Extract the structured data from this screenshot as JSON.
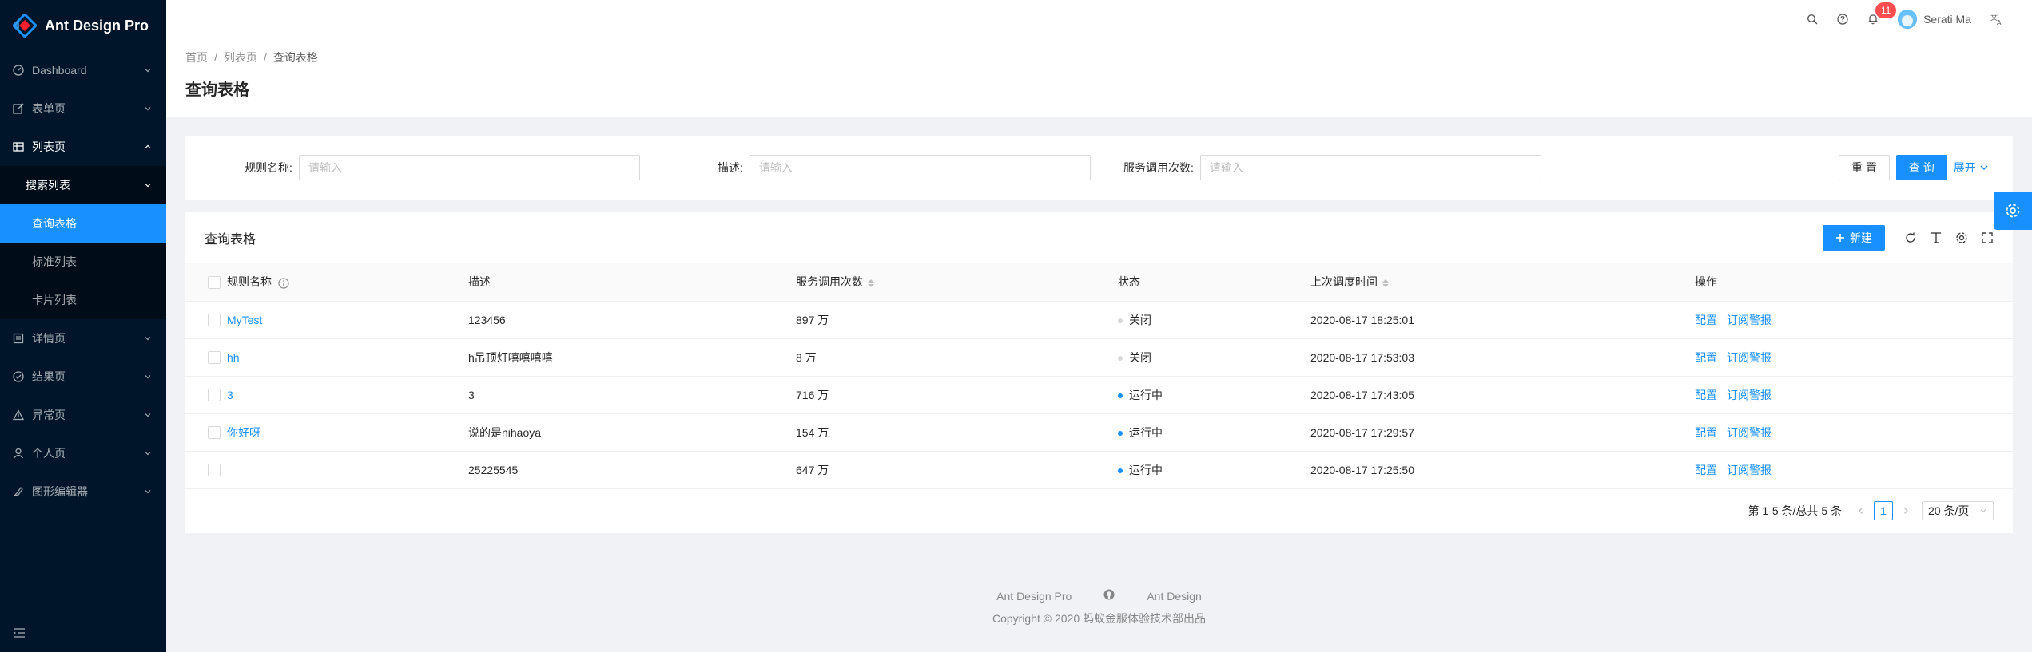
{
  "app": {
    "title": "Ant Design Pro",
    "accent": "#1890ff"
  },
  "sidebar": {
    "items": [
      {
        "label": "Dashboard",
        "icon": "dashboard-icon"
      },
      {
        "label": "表单页",
        "icon": "form-icon"
      },
      {
        "label": "列表页",
        "icon": "table-icon"
      },
      {
        "label": "搜索列表"
      },
      {
        "label": "查询表格"
      },
      {
        "label": "标准列表"
      },
      {
        "label": "卡片列表"
      },
      {
        "label": "详情页",
        "icon": "profile-icon"
      },
      {
        "label": "结果页",
        "icon": "check-circle-icon"
      },
      {
        "label": "异常页",
        "icon": "warning-icon"
      },
      {
        "label": "个人页",
        "icon": "user-icon"
      },
      {
        "label": "图形编辑器",
        "icon": "highlight-icon"
      }
    ]
  },
  "header": {
    "notification_count": "11",
    "username": "Serati Ma"
  },
  "breadcrumb": {
    "items": [
      "首页",
      "列表页",
      "查询表格"
    ],
    "separator": "/"
  },
  "page": {
    "title": "查询表格"
  },
  "search_form": {
    "fields": [
      {
        "label": "规则名称:",
        "placeholder": "请输入"
      },
      {
        "label": "描述:",
        "placeholder": "请输入"
      },
      {
        "label": "服务调用次数:",
        "placeholder": "请输入"
      }
    ],
    "reset_label": "重 置",
    "query_label": "查 询",
    "expand_label": "展开"
  },
  "table": {
    "title": "查询表格",
    "new_label": "新建",
    "columns": [
      "规则名称",
      "描述",
      "服务调用次数",
      "状态",
      "上次调度时间",
      "操作"
    ],
    "rows": [
      {
        "name": "MyTest",
        "desc": "123456",
        "calls": "897 万",
        "status": "关闭",
        "status_color": "#d9d9d9",
        "time": "2020-08-17 18:25:01"
      },
      {
        "name": "hh",
        "desc": "h吊顶灯嘻嘻嘻嘻",
        "calls": "8 万",
        "status": "关闭",
        "status_color": "#d9d9d9",
        "time": "2020-08-17 17:53:03"
      },
      {
        "name": "3",
        "desc": "3",
        "calls": "716 万",
        "status": "运行中",
        "status_color": "#1890ff",
        "time": "2020-08-17 17:43:05"
      },
      {
        "name": "你好呀",
        "desc": "说的是nihaoya",
        "calls": "154 万",
        "status": "运行中",
        "status_color": "#1890ff",
        "time": "2020-08-17 17:29:57"
      },
      {
        "name": "",
        "desc": "25225545",
        "calls": "647 万",
        "status": "运行中",
        "status_color": "#1890ff",
        "time": "2020-08-17 17:25:50"
      }
    ],
    "actions": [
      "配置",
      "订阅警报"
    ],
    "pagination": {
      "total_text": "第 1-5 条/总共 5 条",
      "current": "1",
      "page_size": "20 条/页"
    }
  },
  "footer": {
    "links": [
      "Ant Design Pro",
      "Ant Design"
    ],
    "copyright": "Copyright © 2020 蚂蚁金服体验技术部出品"
  }
}
